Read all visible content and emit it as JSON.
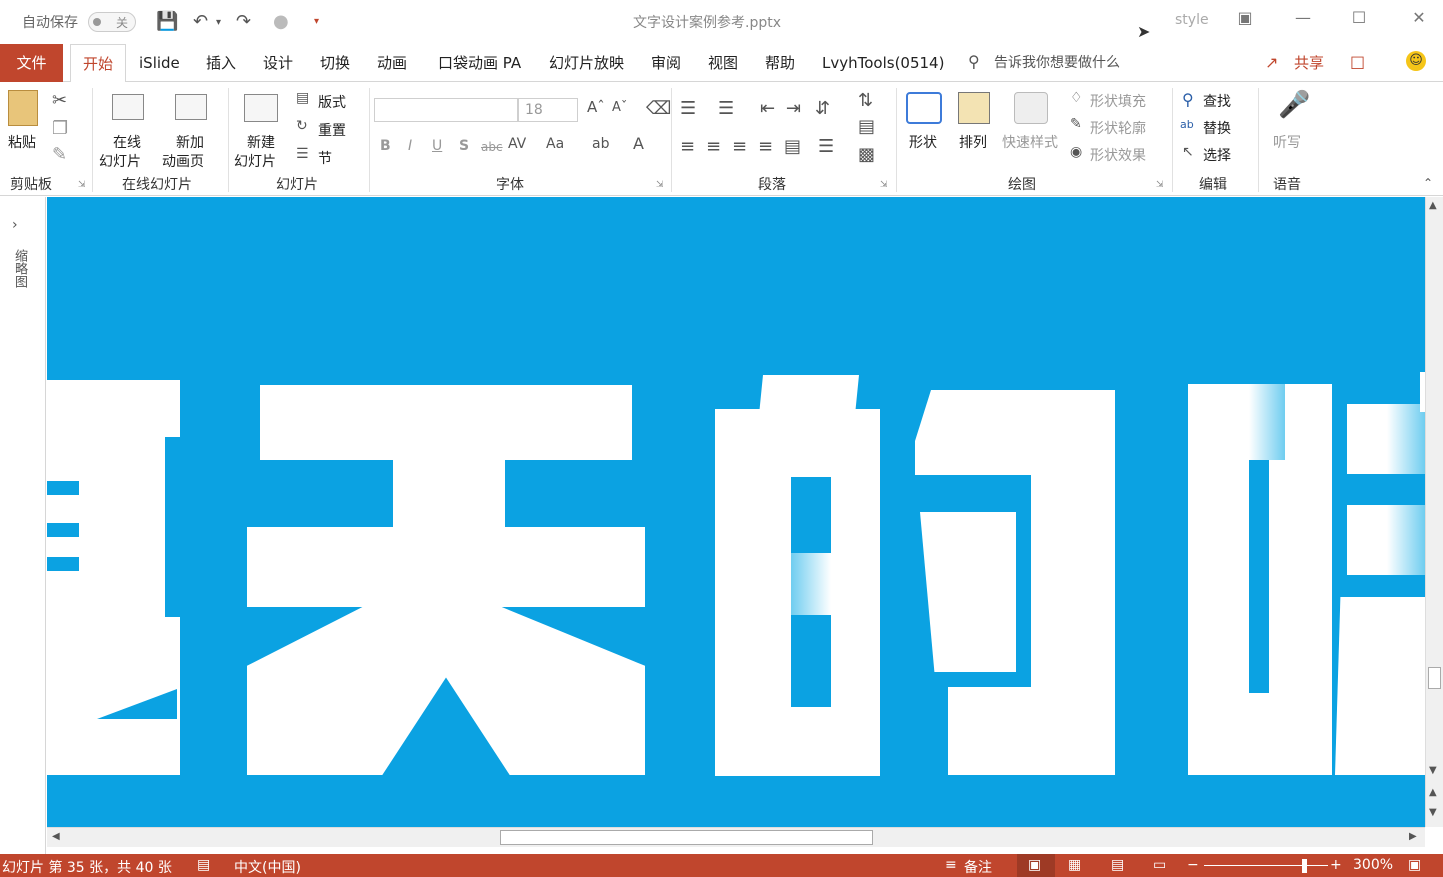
{
  "titlebar": {
    "autosave_label": "自动保存",
    "autosave_state": "关",
    "doc_title": "文字设计案例参考.pptx",
    "style_label": "style"
  },
  "menu": {
    "file": "文件",
    "tabs": [
      "开始",
      "iSlide",
      "插入",
      "设计",
      "切换",
      "动画",
      "口袋动画 PA",
      "幻灯片放映",
      "审阅",
      "视图",
      "帮助",
      "LvyhTools(0514)"
    ],
    "search_placeholder": "告诉我你想要做什么",
    "share": "共享"
  },
  "ribbon": {
    "clipboard": {
      "paste": "粘贴",
      "group": "剪贴板"
    },
    "online": {
      "online_slides": "在线\n幻灯片",
      "new_anim": "新加\n动画页",
      "group": "在线幻灯片",
      "l1": "在线",
      "l2": "幻灯片",
      "l3": "新加",
      "l4": "动画页"
    },
    "slides": {
      "new_slide_1": "新建",
      "new_slide_2": "幻灯片",
      "layout": "版式",
      "reset": "重置",
      "section": "节",
      "group": "幻灯片"
    },
    "font": {
      "font_size": "18",
      "group": "字体",
      "bold": "B",
      "italic": "I",
      "underline": "U",
      "shadow": "S",
      "strike": "abc"
    },
    "paragraph": {
      "group": "段落"
    },
    "drawing": {
      "shape": "形状",
      "arrange": "排列",
      "quick_style": "快速样式",
      "fill": "形状填充",
      "outline": "形状轮廓",
      "effect": "形状效果",
      "group": "绘图"
    },
    "editing": {
      "find": "查找",
      "replace": "替换",
      "select": "选择",
      "group": "编辑"
    },
    "voice": {
      "dictate": "听写",
      "group": "语音"
    }
  },
  "thumbpane": {
    "label": "缩略图"
  },
  "statusbar": {
    "slide_info": "幻灯片 第 35 张，共 40 张",
    "language": "中文(中国)",
    "notes": "备注",
    "zoom": "300%"
  },
  "colors": {
    "accent": "#c0462d",
    "slide_bg": "#0ba2e2"
  }
}
